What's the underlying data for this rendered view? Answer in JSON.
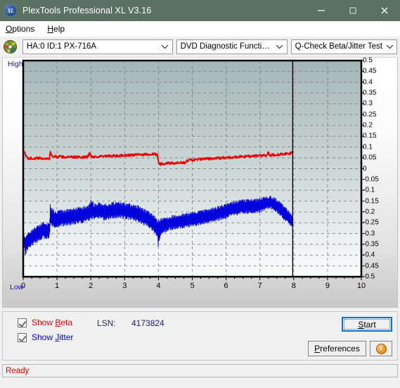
{
  "titlebar": {
    "title": "PlexTools Professional XL V3.16",
    "icon_label": "XL",
    "minimize_label": "—",
    "maximize_label": "□",
    "close_label": "✕"
  },
  "menubar": {
    "items": [
      {
        "label": "Options",
        "accel": "O"
      },
      {
        "label": "Help",
        "accel": "H"
      }
    ]
  },
  "toolbar": {
    "drive_select": "HA:0 ID:1  PX-716A",
    "function_select": "DVD Diagnostic Functions",
    "test_select": "Q-Check Beta/Jitter Test"
  },
  "chart_labels": {
    "high": "High",
    "low": "Low"
  },
  "controls": {
    "show_beta_label": "Show Beta",
    "show_beta_accel": "B",
    "show_beta_checked": true,
    "show_jitter_label": "Show Jitter",
    "show_jitter_accel": "J",
    "show_jitter_checked": true,
    "lsn_label": "LSN:",
    "lsn_value": "4173824",
    "start_label": "Start",
    "start_accel": "S",
    "preferences_label": "Preferences",
    "preferences_accel": "P",
    "info_label": "i"
  },
  "statusbar": {
    "text": "Ready"
  },
  "colors": {
    "titlebar": "#5b7263",
    "beta_series": "#ee0000",
    "jitter_series": "#0000dd",
    "axis_label": "#1414d0",
    "status_text": "#ee0000",
    "plot_top": "#a5b5b5",
    "plot_bottom": "#fcfdfd",
    "marker_line": "#000000"
  },
  "chart_data": {
    "type": "line",
    "title": "Q-Check Beta/Jitter Test",
    "xlabel": "",
    "ylabel": "",
    "xlim": [
      0,
      10
    ],
    "ylim": [
      -0.5,
      0.5
    ],
    "grid": true,
    "xticks": [
      0,
      1,
      2,
      3,
      4,
      5,
      6,
      7,
      8,
      9,
      10
    ],
    "yticks": [
      0.5,
      0.45,
      0.4,
      0.35,
      0.3,
      0.25,
      0.2,
      0.15,
      0.1,
      0.05,
      0,
      -0.05,
      -0.1,
      -0.15,
      -0.2,
      -0.25,
      -0.3,
      -0.35,
      -0.4,
      -0.45,
      -0.5
    ],
    "legend": [
      "Show Beta",
      "Show Jitter"
    ],
    "legend_position": "bottom-left",
    "annotations": [
      {
        "type": "vline",
        "x": 7.97,
        "color": "#000000",
        "label": "recorded-data-end"
      },
      {
        "type": "text",
        "text": "High",
        "position": "top-left-outside"
      },
      {
        "type": "text",
        "text": "Low",
        "position": "bottom-left-outside"
      }
    ],
    "data_extent_x": [
      0.02,
      7.97
    ],
    "series": [
      {
        "name": "Beta",
        "color": "#ee0000",
        "noise": 0.006,
        "x": [
          0.02,
          0.06,
          0.12,
          0.2,
          0.35,
          0.5,
          0.7,
          0.78,
          0.8,
          0.85,
          1.0,
          1.2,
          1.45,
          1.7,
          1.9,
          1.96,
          2.0,
          2.05,
          2.2,
          2.5,
          2.8,
          3.1,
          3.4,
          3.6,
          3.8,
          3.92,
          3.97,
          4.0,
          4.05,
          4.2,
          4.4,
          4.6,
          4.78,
          4.82,
          5.0,
          5.3,
          5.6,
          5.9,
          6.2,
          6.5,
          6.8,
          7.0,
          7.2,
          7.25,
          7.3,
          7.45,
          7.6,
          7.8,
          7.95
        ],
        "y": [
          0.085,
          0.062,
          0.05,
          0.048,
          0.047,
          0.048,
          0.046,
          0.047,
          0.078,
          0.058,
          0.055,
          0.054,
          0.053,
          0.054,
          0.053,
          0.072,
          0.06,
          0.055,
          0.056,
          0.057,
          0.059,
          0.062,
          0.064,
          0.066,
          0.067,
          0.066,
          0.062,
          0.03,
          0.022,
          0.024,
          0.025,
          0.026,
          0.027,
          0.038,
          0.04,
          0.044,
          0.047,
          0.05,
          0.053,
          0.056,
          0.058,
          0.06,
          0.062,
          0.075,
          0.063,
          0.064,
          0.066,
          0.068,
          0.072
        ]
      },
      {
        "name": "Jitter",
        "color": "#0000dd",
        "band": true,
        "x": [
          0.02,
          0.06,
          0.1,
          0.16,
          0.22,
          0.3,
          0.4,
          0.5,
          0.6,
          0.7,
          0.78,
          0.8,
          0.85,
          0.95,
          1.1,
          1.3,
          1.5,
          1.7,
          1.85,
          1.95,
          2.0,
          2.1,
          2.25,
          2.4,
          2.6,
          2.8,
          3.0,
          3.2,
          3.4,
          3.6,
          3.8,
          3.9,
          3.96,
          4.0,
          4.08,
          4.2,
          4.4,
          4.6,
          4.8,
          5.0,
          5.3,
          5.6,
          5.9,
          6.2,
          6.5,
          6.8,
          7.0,
          7.15,
          7.3,
          7.45,
          7.6,
          7.75,
          7.9,
          7.96
        ],
        "y_center": [
          -0.33,
          -0.355,
          -0.345,
          -0.33,
          -0.325,
          -0.315,
          -0.305,
          -0.295,
          -0.285,
          -0.29,
          -0.285,
          -0.215,
          -0.225,
          -0.235,
          -0.23,
          -0.225,
          -0.22,
          -0.215,
          -0.21,
          -0.205,
          -0.185,
          -0.2,
          -0.195,
          -0.2,
          -0.195,
          -0.19,
          -0.195,
          -0.2,
          -0.21,
          -0.225,
          -0.245,
          -0.26,
          -0.275,
          -0.29,
          -0.265,
          -0.26,
          -0.25,
          -0.245,
          -0.24,
          -0.235,
          -0.225,
          -0.215,
          -0.2,
          -0.185,
          -0.175,
          -0.175,
          -0.17,
          -0.16,
          -0.155,
          -0.165,
          -0.185,
          -0.21,
          -0.235,
          -0.245
        ],
        "halfwidth": [
          0.035,
          0.045,
          0.045,
          0.04,
          0.04,
          0.04,
          0.04,
          0.04,
          0.04,
          0.04,
          0.035,
          0.05,
          0.045,
          0.04,
          0.04,
          0.04,
          0.04,
          0.04,
          0.04,
          0.04,
          0.045,
          0.04,
          0.04,
          0.04,
          0.04,
          0.04,
          0.04,
          0.04,
          0.04,
          0.04,
          0.04,
          0.04,
          0.045,
          0.055,
          0.04,
          0.035,
          0.035,
          0.035,
          0.035,
          0.035,
          0.035,
          0.035,
          0.035,
          0.035,
          0.035,
          0.035,
          0.035,
          0.033,
          0.03,
          0.033,
          0.035,
          0.035,
          0.032,
          0.028
        ]
      }
    ]
  }
}
